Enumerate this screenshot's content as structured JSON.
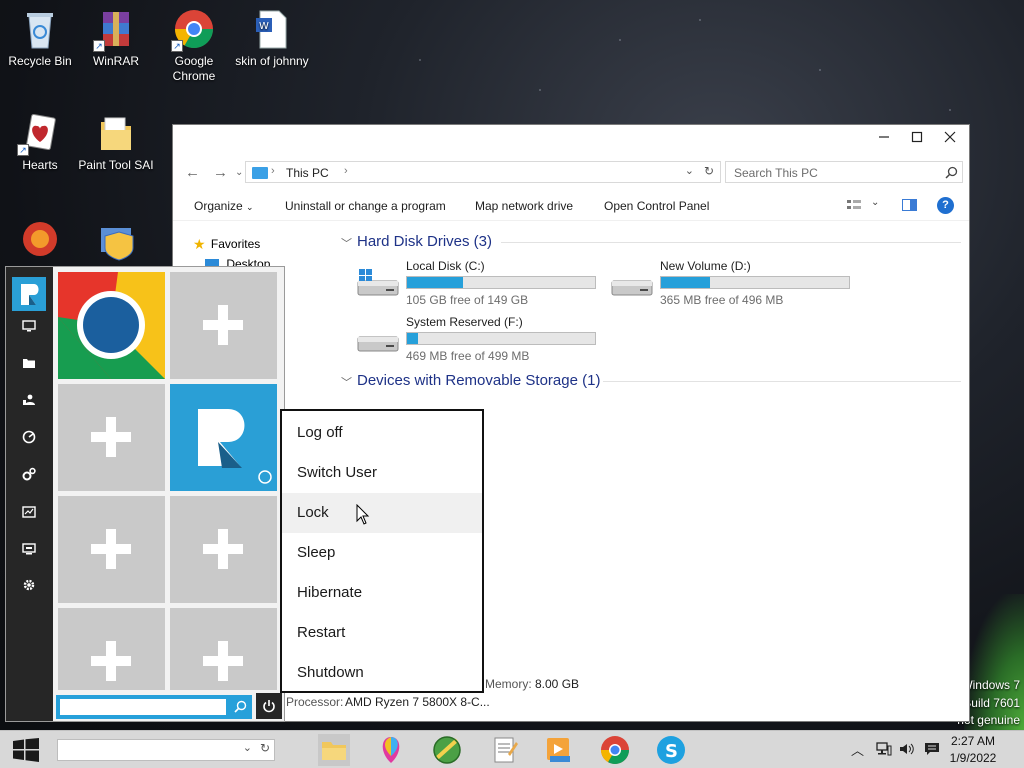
{
  "desktop": {
    "icons": [
      {
        "label": "Recycle Bin"
      },
      {
        "label": "WinRAR"
      },
      {
        "label": "Google Chrome"
      },
      {
        "label": "skin of johnny"
      },
      {
        "label": "Hearts"
      },
      {
        "label": "Paint Tool SAI"
      }
    ],
    "watermark": [
      "Windows 7",
      "Build 7601",
      "not genuine"
    ]
  },
  "explorer": {
    "breadcrumb": "This PC",
    "search_placeholder": "Search This PC",
    "toolbar": {
      "organize": "Organize",
      "uninstall": "Uninstall or change a program",
      "map_drive": "Map network drive",
      "control_panel": "Open Control Panel"
    },
    "nav": {
      "favorites": "Favorites",
      "desktop": "Desktop"
    },
    "hard_disk_section": "Hard Disk Drives (3)",
    "removable_section": "Devices with Removable Storage (1)",
    "drives": [
      {
        "name": "Local Disk (C:)",
        "free": "105 GB free of 149 GB",
        "used_fraction": 0.3
      },
      {
        "name": "New Volume (D:)",
        "free": "365 MB free of 496 MB",
        "used_fraction": 0.26
      },
      {
        "name": "System Reserved (F:)",
        "free": "469 MB free of 499 MB",
        "used_fraction": 0.06
      }
    ],
    "details": {
      "memory_label": "Memory:",
      "memory_value": "8.00 GB",
      "processor_label": "Processor:",
      "processor_value": "AMD Ryzen 7 5800X 8-C..."
    }
  },
  "power_menu": {
    "items": [
      "Log off",
      "Switch User",
      "Lock",
      "Sleep",
      "Hibernate",
      "Restart",
      "Shutdown"
    ],
    "hovered": "Lock"
  },
  "taskbar": {
    "time": "2:27 AM",
    "date": "1/9/2022"
  },
  "colors": {
    "accent": "#26a0da",
    "sidebar": "#262626",
    "tile_empty": "#c9c9c9",
    "tile_app": "#2a9fd6"
  }
}
